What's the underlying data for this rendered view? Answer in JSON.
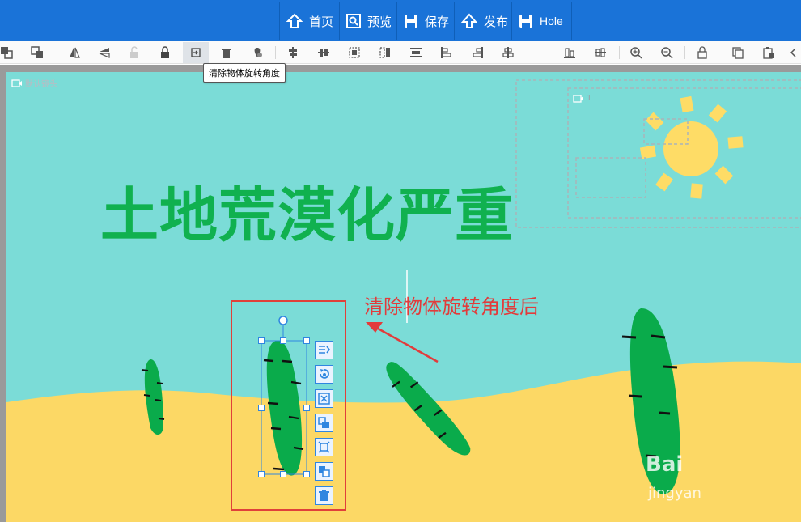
{
  "topbar": {
    "buttons": [
      {
        "label": "首页",
        "icon": "home-icon"
      },
      {
        "label": "预览",
        "icon": "preview-icon"
      },
      {
        "label": "保存",
        "icon": "save-icon"
      },
      {
        "label": "发布",
        "icon": "publish-icon"
      },
      {
        "label": "Hole",
        "icon": "save-icon"
      }
    ]
  },
  "toolbar": {
    "tooltip": "清除物体旋转角度",
    "tools": [
      "bring-forward-icon",
      "send-backward-icon",
      "flip-horizontal-icon",
      "flip-vertical-icon",
      "unlock-icon",
      "lock-icon",
      "clear-rotation-icon",
      "delete-icon",
      "clear-icon",
      "align-left-icon",
      "align-center-icon",
      "group-icon",
      "ungroup-icon",
      "distribute-icon",
      "align-bottom-icon",
      "align-top-icon",
      "align-middle-icon",
      "align-right-icon",
      "align-justify-icon",
      "zoom-in-icon",
      "zoom-out-icon",
      "lock-all-icon",
      "copy-icon",
      "paste-icon",
      "more-icon"
    ]
  },
  "stage": {
    "camera_default": "默认镜头",
    "camera_1": "1",
    "title": "土地荒漠化严重",
    "annotation": "清除物体旋转角度后",
    "watermark": "Bai",
    "watermark_sub": "jingyan"
  },
  "colors": {
    "topbar": "#1a73d8",
    "sky": "#7bdcd7",
    "sand": "#fcd865",
    "cactus": "#0aab4b",
    "title": "#10b14f",
    "sun": "#fedc66",
    "annotation": "#e23b3b"
  },
  "side_tools": [
    "arrange-icon",
    "rotate-reset-icon",
    "fit-icon",
    "crop-icon",
    "scale-icon",
    "duplicate-icon",
    "trash-icon"
  ]
}
